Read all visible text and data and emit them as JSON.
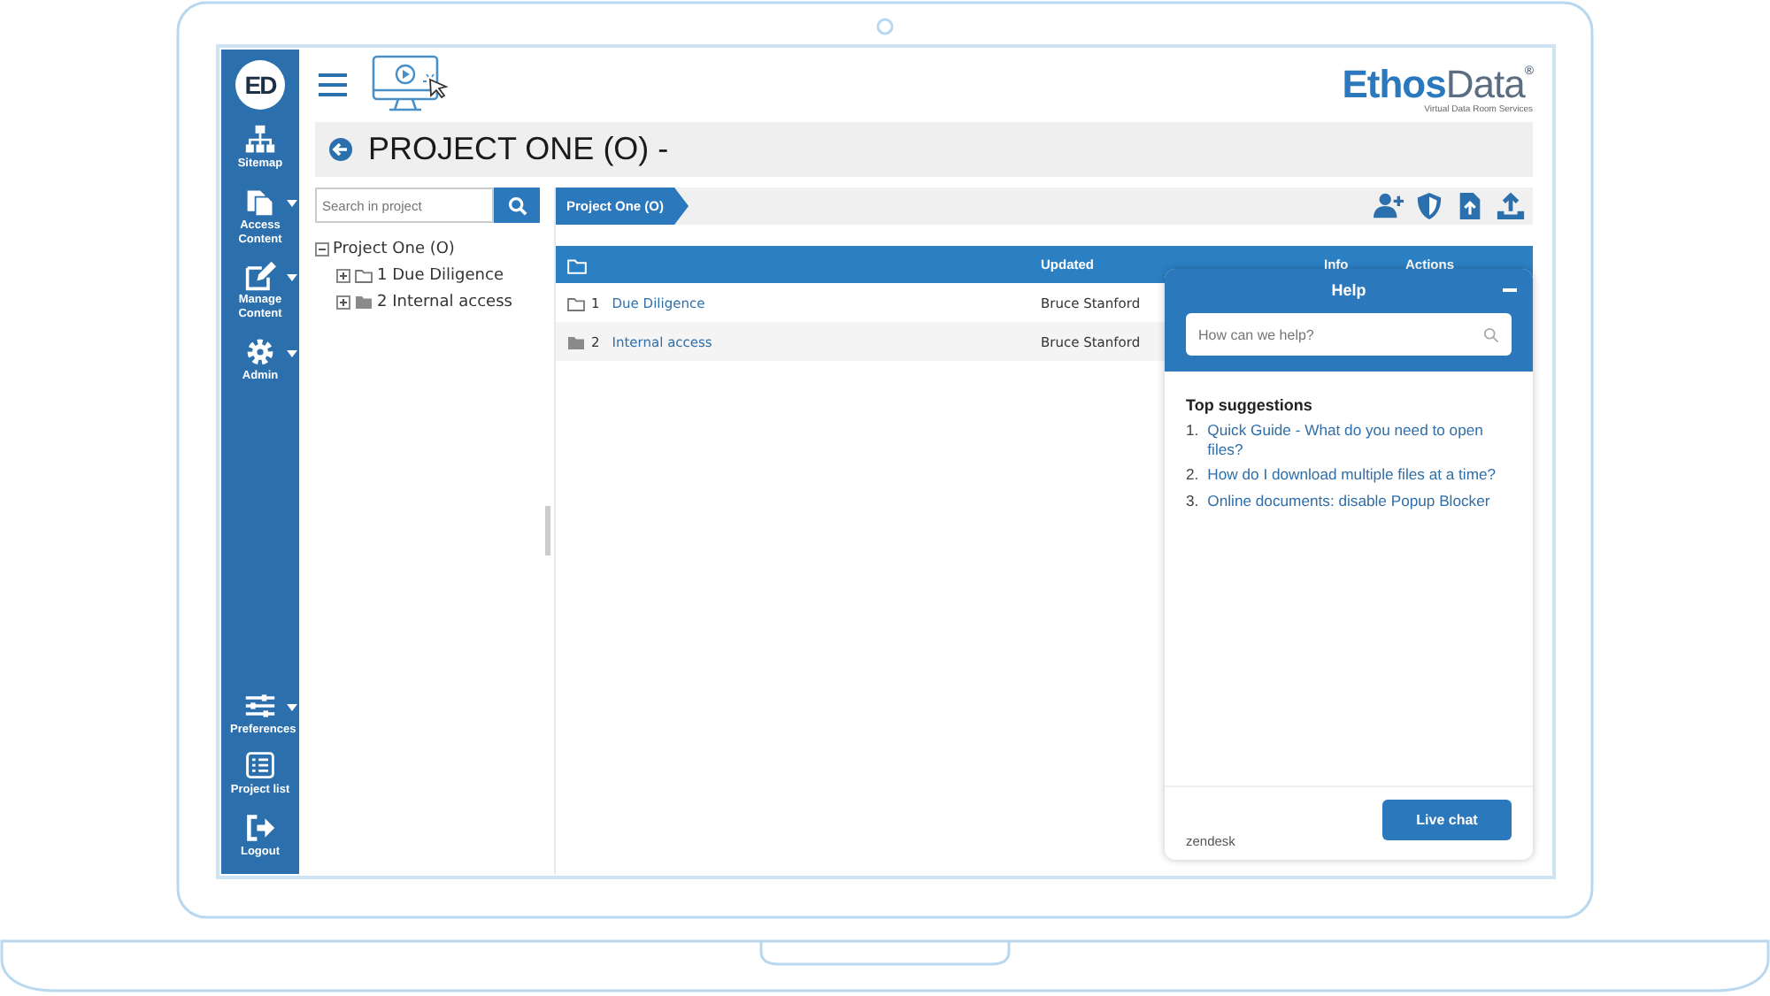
{
  "sidebar": {
    "logo": "ED",
    "top_items": [
      {
        "label": "Sitemap",
        "dropdown": false
      },
      {
        "label": "Access Content",
        "dropdown": true
      },
      {
        "label": "Manage Content",
        "dropdown": true
      },
      {
        "label": "Admin",
        "dropdown": true
      }
    ],
    "bottom_items": [
      {
        "label": "Preferences",
        "dropdown": true
      },
      {
        "label": "Project list",
        "dropdown": false
      },
      {
        "label": "Logout",
        "dropdown": false
      }
    ]
  },
  "brand": {
    "name_strong": "Ethos",
    "name_light": "Data",
    "mark": "®",
    "tagline": "Virtual Data Room Services"
  },
  "title": "PROJECT ONE (O) -",
  "search": {
    "placeholder": "Search in project"
  },
  "tree": [
    {
      "label": "Project One (O)",
      "expanded": true,
      "children": [
        {
          "label": "1 Due Diligence",
          "expanded": false,
          "kind": "outline"
        },
        {
          "label": "2 Internal access",
          "expanded": false,
          "kind": "solid"
        }
      ]
    }
  ],
  "breadcrumb": [
    "Project One (O)"
  ],
  "table": {
    "columns": [
      "Updated",
      "Info",
      "Actions"
    ],
    "rows": [
      {
        "number": "1",
        "name": "Due Diligence",
        "updated": "Bruce Stanford",
        "kind": "outline"
      },
      {
        "number": "2",
        "name": "Internal access",
        "updated": "Bruce Stanford",
        "kind": "solid"
      }
    ]
  },
  "help": {
    "title": "Help",
    "placeholder": "How can we help?",
    "heading": "Top suggestions",
    "suggestions": [
      {
        "number": "1.",
        "text": "Quick Guide - What do you need to open files?"
      },
      {
        "number": "2.",
        "text": "How do I download multiple files at a time?"
      },
      {
        "number": "3.",
        "text": "Online documents: disable Popup Blocker"
      }
    ],
    "footer": "zendesk",
    "button": "Live chat"
  }
}
